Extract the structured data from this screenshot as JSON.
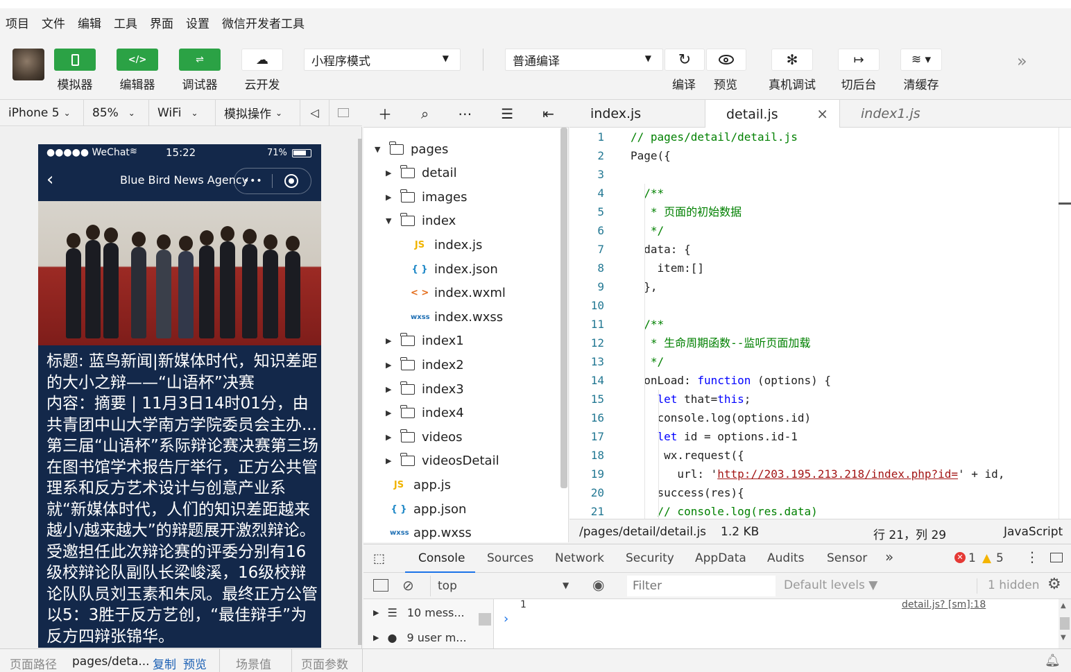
{
  "menu": [
    "项目",
    "文件",
    "编辑",
    "工具",
    "界面",
    "设置",
    "微信开发者工具"
  ],
  "toolbar": {
    "simulator_label": "模拟器",
    "editor_label": "编辑器",
    "debugger_label": "调试器",
    "cloud_label": "云开发",
    "mode_value": "小程序模式",
    "compile_mode_value": "普通编译",
    "compile_label": "编译",
    "preview_label": "预览",
    "remote_debug_label": "真机调试",
    "background_label": "切后台",
    "clear_cache_label": "清缓存"
  },
  "simulator": {
    "device": "iPhone 5",
    "zoom": "85%",
    "network": "WiFi",
    "operation": "模拟操作"
  },
  "phone": {
    "carrier": "●●●●● WeChat",
    "time": "15:22",
    "battery": "71%",
    "nav_title": "Blue Bird News Agency",
    "article_text": "标题: 蓝鸟新闻|新媒体时代，知识差距的大小之辩——“山语杯”决赛\n内容：摘要 | 11月3日14时01分，由共青团中山大学南方学院委员会主办...第三届“山语杯”系际辩论赛决赛第三场在图书馆学术报告厅举行，正方公共管理系和反方艺术设计与创意产业系就“新媒体时代，人们的知识差距越来越小/越来越大”的辩题展开激烈辩论。受邀担任此次辩论赛的评委分别有16级校辩论队副队长梁峻溪，16级校辩论队队员刘玉素和朱凤。最终正方公管以5：3胜于反方艺创，“最佳辩手”为反方四辩张锦华。"
  },
  "filetree": {
    "items": [
      {
        "label": "pages",
        "type": "folder",
        "open": true,
        "level": 0
      },
      {
        "label": "detail",
        "type": "folder",
        "open": false,
        "level": 1
      },
      {
        "label": "images",
        "type": "folder",
        "open": false,
        "level": 1
      },
      {
        "label": "index",
        "type": "folder",
        "open": true,
        "level": 1
      },
      {
        "label": "index.js",
        "type": "js",
        "level": 2
      },
      {
        "label": "index.json",
        "type": "json",
        "level": 2
      },
      {
        "label": "index.wxml",
        "type": "wxml",
        "level": 2
      },
      {
        "label": "index.wxss",
        "type": "wxss",
        "level": 2
      },
      {
        "label": "index1",
        "type": "folder",
        "open": false,
        "level": 1
      },
      {
        "label": "index2",
        "type": "folder",
        "open": false,
        "level": 1
      },
      {
        "label": "index3",
        "type": "folder",
        "open": false,
        "level": 1
      },
      {
        "label": "index4",
        "type": "folder",
        "open": false,
        "level": 1
      },
      {
        "label": "videos",
        "type": "folder",
        "open": false,
        "level": 1
      },
      {
        "label": "videosDetail",
        "type": "folder",
        "open": false,
        "level": 1
      },
      {
        "label": "app.js",
        "type": "js",
        "level": 0
      },
      {
        "label": "app.json",
        "type": "json",
        "level": 0
      },
      {
        "label": "app.wxss",
        "type": "wxss",
        "level": 0
      }
    ]
  },
  "tabs": {
    "tab1": "index.js",
    "tab2": "detail.js",
    "tab3": "index1.js"
  },
  "editor": {
    "lines": [
      "// pages/detail/detail.js",
      "Page({",
      "",
      "  /**",
      "   * 页面的初始数据",
      "   */",
      "  data: {",
      "    item:[]",
      "  },",
      "",
      "  /**",
      "   * 生命周期函数--监听页面加载",
      "   */",
      "  onLoad: function (options) {",
      "    let that=this;",
      "    console.log(options.id)",
      "    let id = options.id-1",
      "     wx.request({",
      "       url: 'http://203.195.213.218/index.php?id=' + id,",
      "    success(res){",
      "    // console.log(res.data)"
    ]
  },
  "editor_status": {
    "path": "/pages/detail/detail.js",
    "size": "1.2 KB",
    "cursor": "行 21，列 29",
    "language": "JavaScript"
  },
  "devtools": {
    "tabs": [
      "Console",
      "Sources",
      "Network",
      "Security",
      "AppData",
      "Audits",
      "Sensor"
    ],
    "errors": "1",
    "warnings": "5",
    "context": "top",
    "filter_placeholder": "Filter",
    "levels": "Default levels ▼",
    "hidden": "1 hidden",
    "messages_label": "10 mess...",
    "user_messages_label": "9 user m...",
    "source_link": "detail.js? [sm]:18"
  },
  "bottombar": {
    "path_label": "页面路径",
    "path_value": "pages/deta...",
    "copy": "复制",
    "preview": "预览",
    "scene": "场景值",
    "params": "页面参数"
  }
}
